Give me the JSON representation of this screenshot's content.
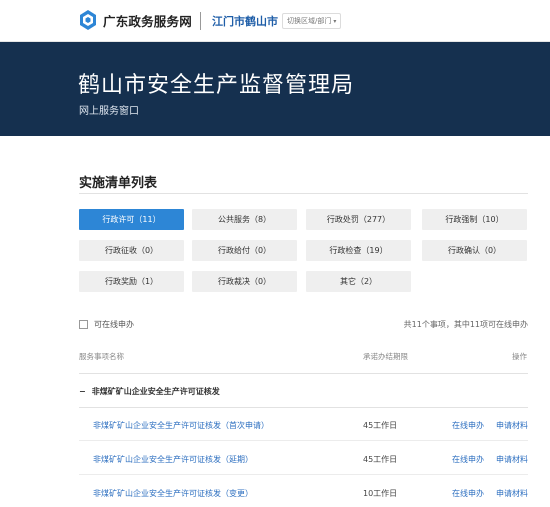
{
  "header": {
    "site_name": "广东政务服务网",
    "city": "江门市鹤山市",
    "switch_label": "切换区域/部门",
    "switch_caret": "▾"
  },
  "banner": {
    "title": "鹤山市安全生产监督管理局",
    "subtitle": "网上服务窗口"
  },
  "section": {
    "title": "实施清单列表"
  },
  "categories": [
    {
      "label": "行政许可（11）",
      "active": true
    },
    {
      "label": "公共服务（8）"
    },
    {
      "label": "行政处罚（277）"
    },
    {
      "label": "行政强制（10）"
    },
    {
      "label": "行政征收（0）"
    },
    {
      "label": "行政给付（0）"
    },
    {
      "label": "行政检查（19）"
    },
    {
      "label": "行政确认（0）"
    },
    {
      "label": "行政奖励（1）"
    },
    {
      "label": "行政裁决（0）"
    },
    {
      "label": "其它（2）"
    }
  ],
  "filter": {
    "online_only_label": "可在线申办",
    "summary": "共11个事项，其中11项可在线申办"
  },
  "table": {
    "headers": {
      "name": "服务事项名称",
      "days": "承诺办结期限",
      "ops": "操作"
    },
    "group": {
      "toggle": "−",
      "title": "非煤矿矿山企业安全生产许可证核发"
    },
    "rows": [
      {
        "name": "非煤矿矿山企业安全生产许可证核发（首次申请）",
        "days": "45工作日",
        "apply": "在线申办",
        "materials": "申请材料"
      },
      {
        "name": "非煤矿矿山企业安全生产许可证核发（延期）",
        "days": "45工作日",
        "apply": "在线申办",
        "materials": "申请材料"
      },
      {
        "name": "非煤矿矿山企业安全生产许可证核发（变更）",
        "days": "10工作日",
        "apply": "在线申办",
        "materials": "申请材料"
      }
    ]
  },
  "colors": {
    "banner_bg": "#15304f",
    "accent": "#2d86d6",
    "link": "#2d6fc0"
  }
}
